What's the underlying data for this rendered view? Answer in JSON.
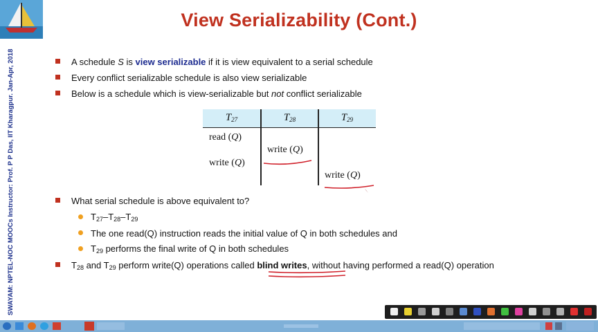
{
  "title": "View Serializability (Cont.)",
  "side_text": "SWAYAM: NPTEL-NOC MOOCs Instructor: Prof. P P Das, IIT Kharagpur. Jan-Apr, 2018",
  "bullets": {
    "b1_pre": "A schedule ",
    "b1_s": "S",
    "b1_mid": " is ",
    "b1_bold": "view serializable",
    "b1_post": " if it is view equivalent to a serial schedule",
    "b2": "Every conflict serializable schedule is also view serializable",
    "b3_pre": "Below is a schedule which is view-serializable but ",
    "b3_em": "not",
    "b3_post": " conflict serializable",
    "b4": "What serial schedule is above equivalent to?",
    "s1": {
      "t": "T",
      "a": "27",
      "dash1": "–T",
      "b": "28",
      "dash2": "–T",
      "c": "29"
    },
    "s2": "The one read(Q) instruction reads the initial value of Q in both schedules and",
    "s3_t": "T",
    "s3_sub": "29",
    "s3_post": " performs the final write of Q in both schedules",
    "b5_t1": "T",
    "b5_sub1": "28",
    "b5_and": " and T",
    "b5_sub2": "29",
    "b5_mid": " perform write(Q) operations called ",
    "b5_bold": "blind writes",
    "b5_post": ", without having performed a read(Q) operation"
  },
  "table": {
    "headers": [
      {
        "t": "T",
        "sub": "27"
      },
      {
        "t": "T",
        "sub": "28"
      },
      {
        "t": "T",
        "sub": "29"
      }
    ],
    "c1_read": "read (",
    "c1_write": "write (",
    "c2_write": "write (",
    "c3_write": "write (",
    "q": "Q",
    "close": ")"
  },
  "annotation_color": "#d0202a",
  "accent_color": "#c0311f"
}
